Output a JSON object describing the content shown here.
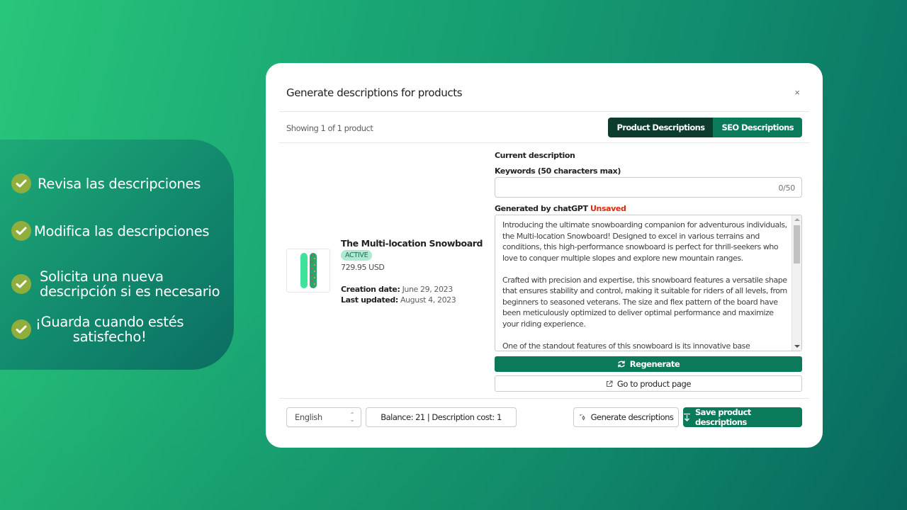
{
  "promo": {
    "items": [
      {
        "text": "Revisa las descripciones",
        "icon": "check-circle-icon"
      },
      {
        "text": "Modifica las descripciones",
        "icon": "check-circle-icon"
      },
      {
        "text_line1": "Solicita una nueva",
        "text_line2": "descripción si es necesario",
        "icon": "check-circle-icon"
      },
      {
        "text_line1": "¡Guarda cuando estés",
        "text_line2": "satisfecho!",
        "icon": "check-circle-icon"
      }
    ]
  },
  "modal": {
    "title": "Generate descriptions for products",
    "close_label": "×",
    "showing": "Showing 1 of 1 product",
    "tabs": [
      {
        "label": "Product Descriptions",
        "active": true
      },
      {
        "label": "SEO Descriptions",
        "active": false
      }
    ],
    "product": {
      "name": "The Multi-location Snowboard",
      "status": "ACTIVE",
      "price": "729.95 USD",
      "creation_label": "Creation date:",
      "creation_value": "June 29, 2023",
      "updated_label": "Last updated:",
      "updated_value": "August 4, 2023"
    },
    "current_description_label": "Current description",
    "keywords": {
      "label": "Keywords (50 characters max)",
      "value": "",
      "counter": "0/50"
    },
    "generated": {
      "label": "Generated by chatGPT",
      "status": "Unsaved",
      "paragraphs": [
        "Introducing the ultimate snowboarding companion for adventurous individuals, the Multi-location Snowboard! Designed to excel in various terrains and conditions, this high-performance snowboard is perfect for thrill-seekers who love to conquer multiple slopes and explore new mountain ranges.",
        "Crafted with precision and expertise, this snowboard features a versatile shape that ensures stability and control, making it suitable for riders of all levels, from beginners to seasoned veterans. The size and flex pattern of the board have been meticulously optimized to deliver optimal performance and maximize your riding experience.",
        "One of the standout features of this snowboard is its innovative base technology."
      ]
    },
    "buttons": {
      "regenerate": "Regenerate",
      "go_to_product": "Go to product page",
      "generate": "Generate descriptions",
      "save": "Save product descriptions"
    },
    "footer": {
      "language": "English",
      "balance": "Balance: 21 | Description cost: 1"
    }
  },
  "colors": {
    "brand_green": "#0b7a5a",
    "tab_active": "#0d3b2e",
    "unsaved_red": "#d72c0d",
    "badge_bg": "#aee9d1",
    "check_olive": "#8fae3c"
  }
}
